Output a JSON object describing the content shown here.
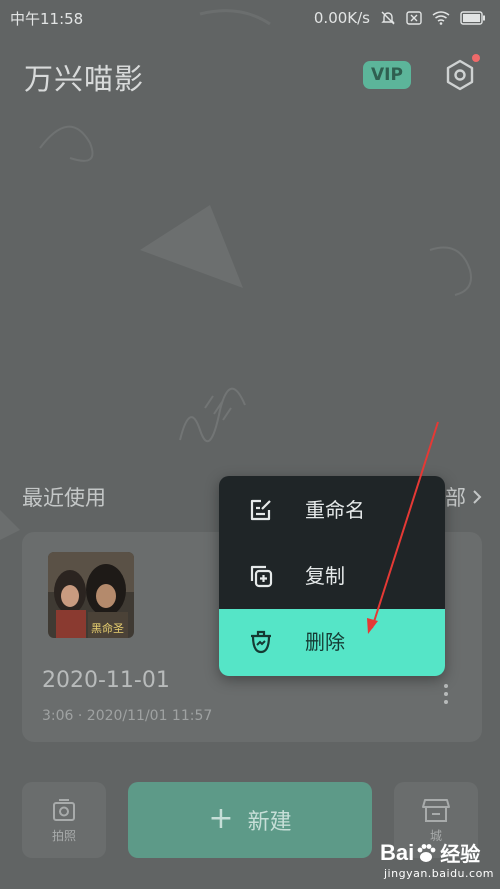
{
  "status_bar": {
    "time": "中午11:58",
    "speed": "0.00K/s",
    "icons": [
      "mute-icon",
      "sim-off-icon",
      "wifi-icon",
      "battery-icon"
    ]
  },
  "header": {
    "app_title": "万兴喵影",
    "vip_label": "VIP",
    "settings_icon": "settings-hexagon-icon"
  },
  "recent": {
    "section_title": "最近使用",
    "see_all_label": "部",
    "project": {
      "date": "2020-11-01",
      "meta": "3:06 · 2020/11/01 11:57",
      "thumbnail_caption": "黑命圣"
    }
  },
  "context_menu": {
    "items": [
      {
        "label": "重命名",
        "icon": "rename-icon"
      },
      {
        "label": "复制",
        "icon": "copy-icon"
      },
      {
        "label": "删除",
        "icon": "delete-icon"
      }
    ]
  },
  "bottom_bar": {
    "shoot_label": "拍照",
    "new_label": "新建",
    "store_label": "城"
  },
  "watermark": {
    "brand": "Bai",
    "brand_suffix": "经验",
    "url": "jingyan.baidu.com"
  },
  "colors": {
    "accent": "#55e5c7",
    "menu_bg": "#1f2527",
    "overlay_bg": "#616464",
    "annotation": "#e53935"
  }
}
